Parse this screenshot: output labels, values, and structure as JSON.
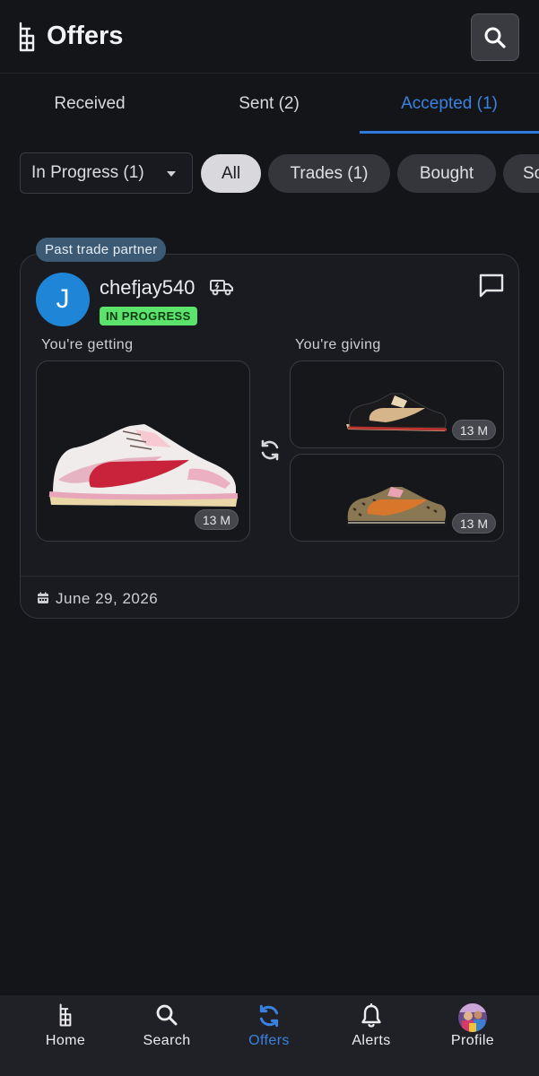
{
  "header": {
    "title": "Offers",
    "logo_icon": "app-logo-icon",
    "search_icon": "search-icon"
  },
  "tabs": [
    {
      "label": "Received",
      "active": false
    },
    {
      "label": "Sent (2)",
      "active": false
    },
    {
      "label": "Accepted (1)",
      "active": true
    }
  ],
  "filters": {
    "dropdown_value": "In Progress (1)",
    "chips": [
      {
        "label": "All",
        "selected": true
      },
      {
        "label": "Trades (1)",
        "selected": false
      },
      {
        "label": "Bought",
        "selected": false
      },
      {
        "label": "So",
        "selected": false
      }
    ]
  },
  "offer_card": {
    "badge": "Past trade partner",
    "avatar_initial": "J",
    "username": "chefjay540",
    "status": "IN PROGRESS",
    "getting_label": "You're getting",
    "giving_label": "You're giving",
    "getting_items": [
      {
        "size": "13 M",
        "image": "pink-red-low-sneaker"
      }
    ],
    "giving_items": [
      {
        "size": "13 M",
        "image": "black-tan-low-sneaker"
      },
      {
        "size": "13 M",
        "image": "leopard-orange-low-sneaker"
      }
    ],
    "date": "June 29, 2026"
  },
  "bottom_nav": [
    {
      "label": "Home",
      "icon": "home-logo-icon",
      "active": false
    },
    {
      "label": "Search",
      "icon": "search-icon",
      "active": false
    },
    {
      "label": "Offers",
      "icon": "offers-sync-icon",
      "active": true
    },
    {
      "label": "Alerts",
      "icon": "bell-icon",
      "active": false
    },
    {
      "label": "Profile",
      "icon": "profile-avatar",
      "active": false
    }
  ],
  "colors": {
    "accent": "#2f7bdc",
    "status_green": "#5be36b",
    "avatar_blue": "#1f85d6",
    "background": "#141519"
  }
}
